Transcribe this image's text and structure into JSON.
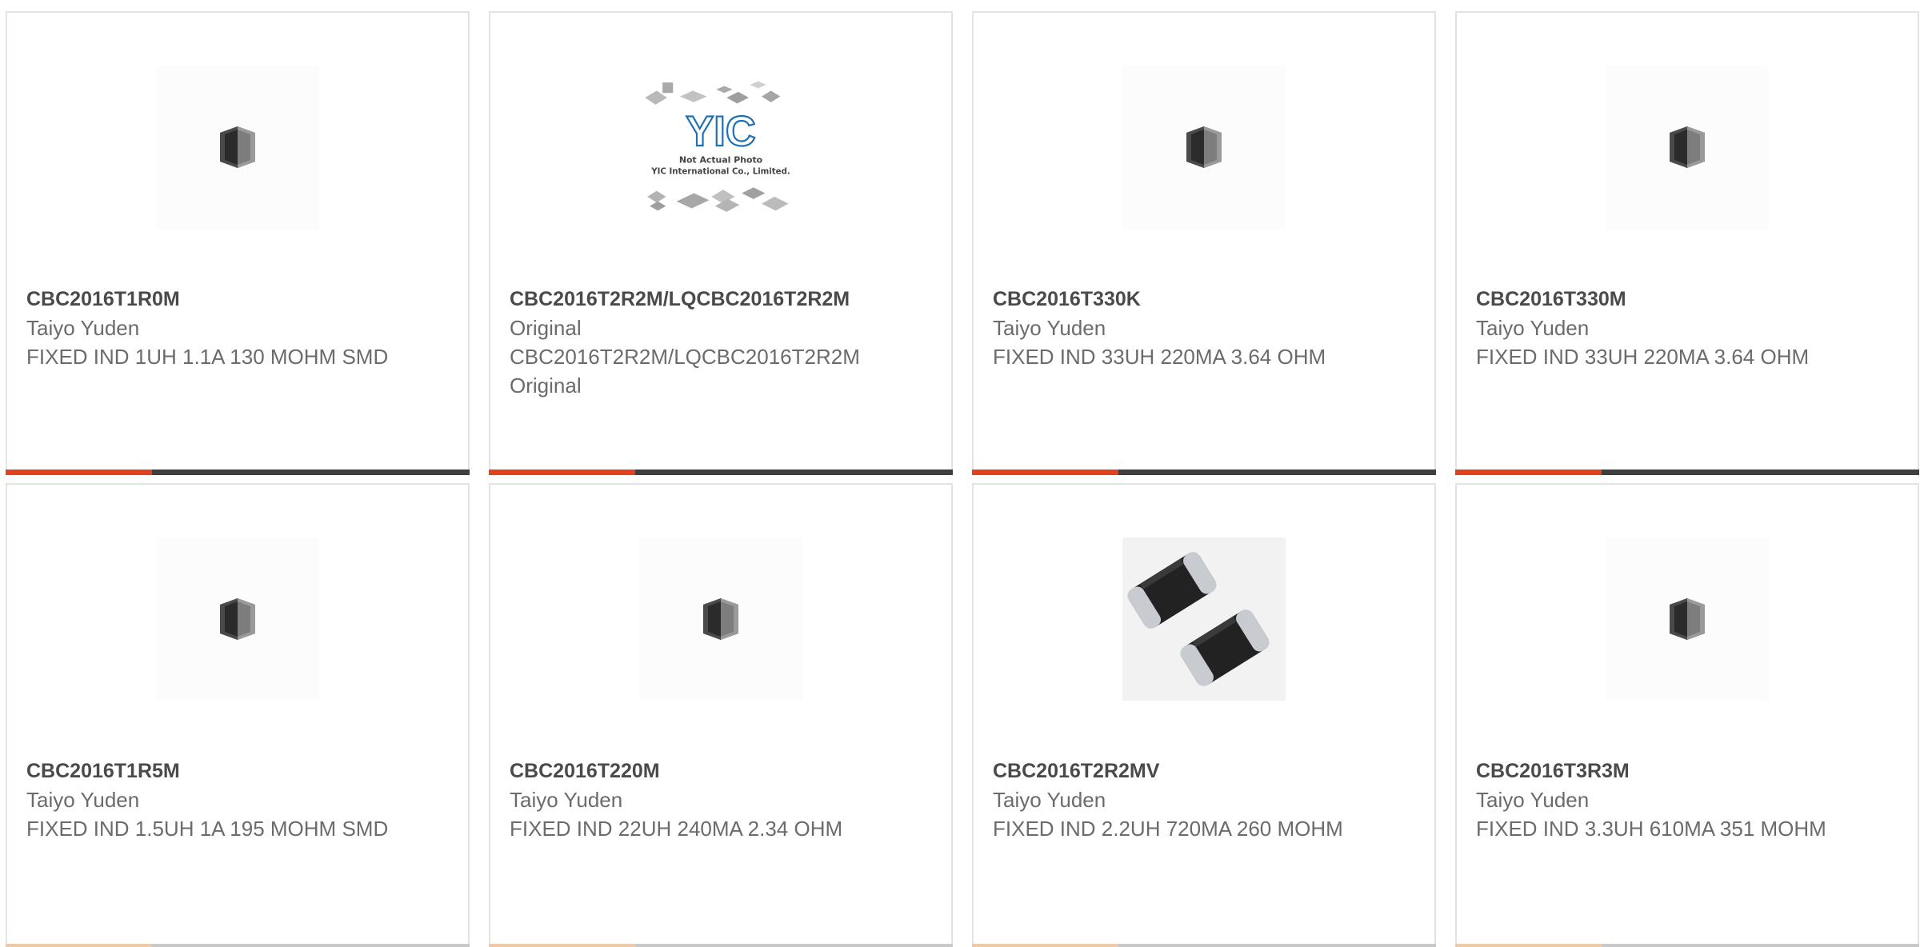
{
  "colors": {
    "accent": "#e1431f",
    "bar_dark": "#3f3f3f",
    "title": "#4a4a4a",
    "text": "#6b6b6b",
    "border": "#e3e3e3"
  },
  "products": [
    {
      "part_number": "CBC2016T1R0M",
      "manufacturer": "Taiyo Yuden",
      "description": "FIXED IND 1UH 1.1A 130 MOHM SMD",
      "image": "inductor-chip-icon"
    },
    {
      "part_number": "CBC2016T2R2M/LQCBC2016T2R2M",
      "manufacturer": "Original",
      "description": "CBC2016T2R2M/LQCBC2016T2R2M Original",
      "image": "placeholder-not-actual-photo",
      "image_logo": "YIC",
      "image_caption_1": "Not Actual Photo",
      "image_caption_2": "YIC International Co., Limited."
    },
    {
      "part_number": "CBC2016T330K",
      "manufacturer": "Taiyo Yuden",
      "description": "FIXED IND 33UH 220MA 3.64 OHM",
      "image": "inductor-chip-icon"
    },
    {
      "part_number": "CBC2016T330M",
      "manufacturer": "Taiyo Yuden",
      "description": "FIXED IND 33UH 220MA 3.64 OHM",
      "image": "inductor-chip-icon"
    },
    {
      "part_number": "CBC2016T1R5M",
      "manufacturer": "Taiyo Yuden",
      "description": "FIXED IND 1.5UH 1A 195 MOHM SMD",
      "image": "inductor-chip-icon"
    },
    {
      "part_number": "CBC2016T220M",
      "manufacturer": "Taiyo Yuden",
      "description": "FIXED IND 22UH 240MA 2.34 OHM",
      "image": "inductor-chip-icon"
    },
    {
      "part_number": "CBC2016T2R2MV",
      "manufacturer": "Taiyo Yuden",
      "description": "FIXED IND 2.2UH 720MA 260 MOHM",
      "image": "two-chip-inductors-icon"
    },
    {
      "part_number": "CBC2016T3R3M",
      "manufacturer": "Taiyo Yuden",
      "description": "FIXED IND 3.3UH 610MA 351 MOHM",
      "image": "inductor-chip-icon"
    }
  ]
}
